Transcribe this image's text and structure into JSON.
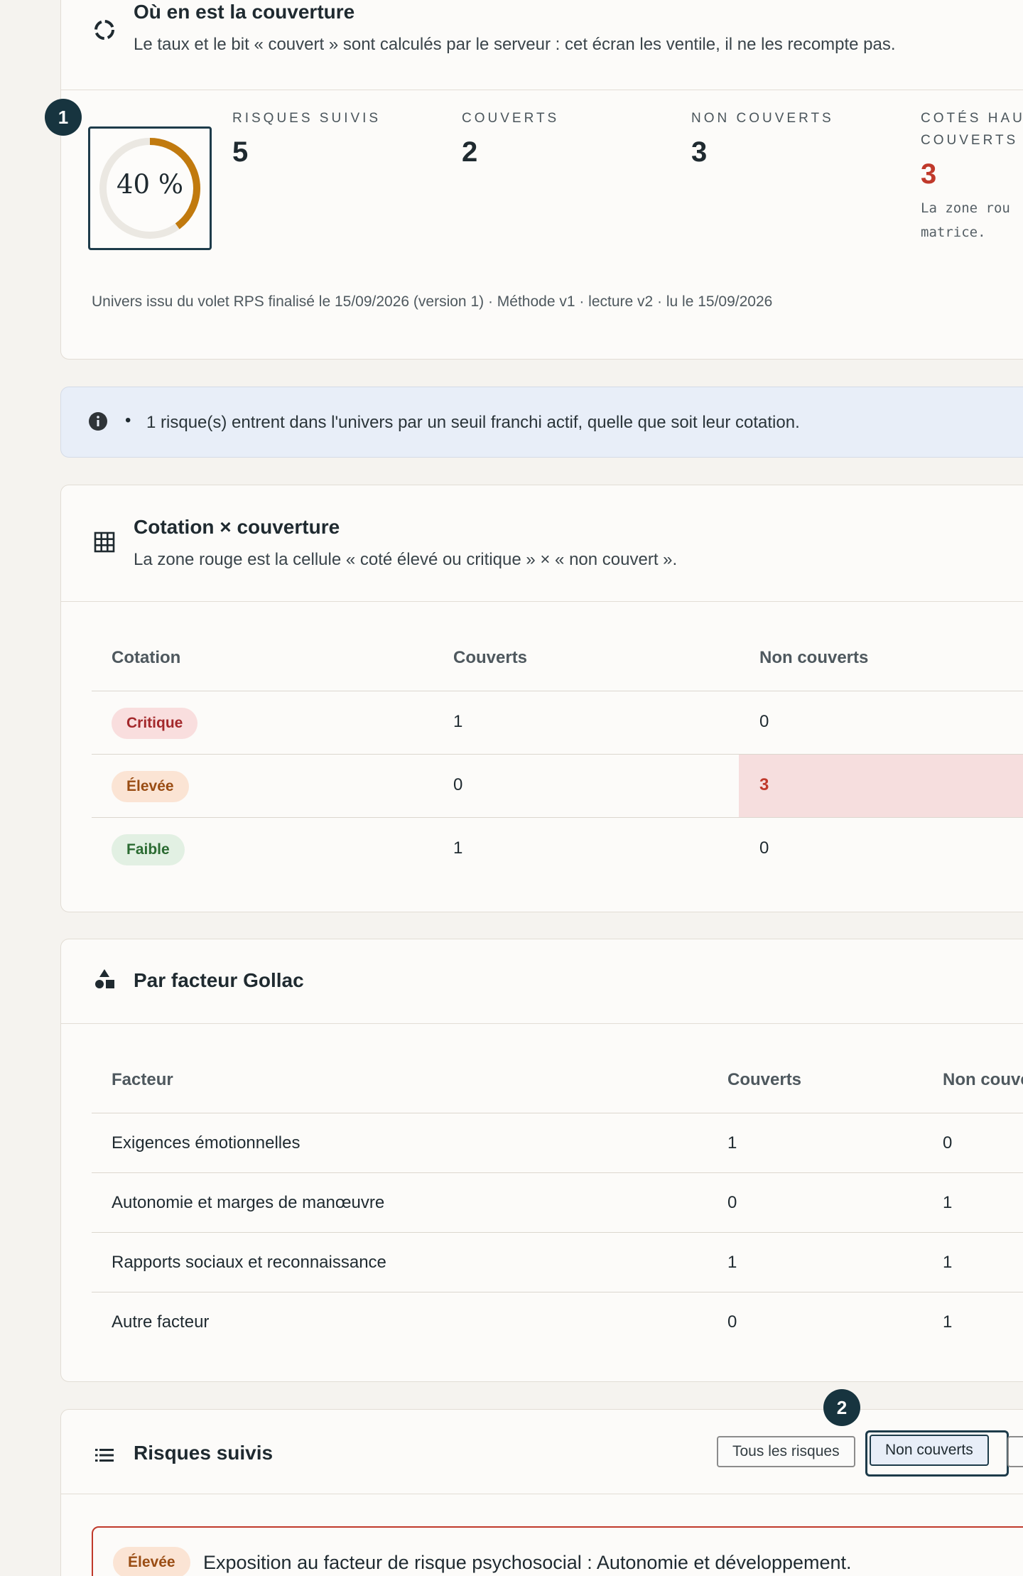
{
  "coverage": {
    "title": "Où en est la couverture",
    "subtitle": "Le taux et le bit « couvert » sont calculés par le serveur : cet écran les ventile, il ne les recompte pas.",
    "ring_label": "40 %",
    "ring_fraction": 0.4,
    "marker": "1",
    "stats": [
      {
        "label": "RISQUES SUIVIS",
        "value": "5"
      },
      {
        "label": "COUVERTS",
        "value": "2"
      },
      {
        "label": "NON COUVERTS",
        "value": "3"
      },
      {
        "label_line1": "COTÉS HAUT",
        "label_line2": "COUVERTS",
        "value": "3",
        "note_line1": "La zone rou",
        "note_line2": "matrice."
      }
    ],
    "meta": "Univers issu du volet RPS finalisé le 15/09/2026 (version 1) · Méthode v1 · lecture v2 · lu le 15/09/2026",
    "colors": {
      "ring": "#c17a0e",
      "track": "#ebe8e2",
      "alert": "#c0392b"
    }
  },
  "info": {
    "bullet": "•",
    "text": "1 risque(s) entrent dans l'univers par un seuil franchi actif, quelle que soit leur cotation.",
    "icon": "info-icon"
  },
  "matrix": {
    "title": "Cotation × couverture",
    "subtitle": "La zone rouge est la cellule « coté élevé ou critique » × « non couvert ».",
    "icon": "grid-icon",
    "headers": [
      "Cotation",
      "Couverts",
      "Non couverts"
    ],
    "rows": [
      {
        "cotation": "Critique",
        "couverts": "1",
        "non_couverts": "0"
      },
      {
        "cotation": "Élevée",
        "couverts": "0",
        "non_couverts": "3"
      },
      {
        "cotation": "Faible",
        "couverts": "1",
        "non_couverts": "0"
      }
    ]
  },
  "gollac": {
    "title": "Par facteur Gollac",
    "icon": "shapes-icon",
    "headers": [
      "Facteur",
      "Couverts",
      "Non couve"
    ],
    "rows": [
      {
        "facteur": "Exigences émotionnelles",
        "couverts": "1",
        "non_couverts": "0"
      },
      {
        "facteur": "Autonomie et marges de manœuvre",
        "couverts": "0",
        "non_couverts": "1"
      },
      {
        "facteur": "Rapports sociaux et reconnaissance",
        "couverts": "1",
        "non_couverts": "1"
      },
      {
        "facteur": "Autre facteur",
        "couverts": "0",
        "non_couverts": "1"
      }
    ]
  },
  "risks": {
    "title": "Risques suivis",
    "icon": "list-icon",
    "marker": "2",
    "filters": [
      "Tous les risques",
      "Non couverts"
    ],
    "active_filter": "Non couverts",
    "first_risk": {
      "badge": "Élevée",
      "title": "Exposition au facteur de risque psychosocial : Autonomie et développement."
    }
  }
}
